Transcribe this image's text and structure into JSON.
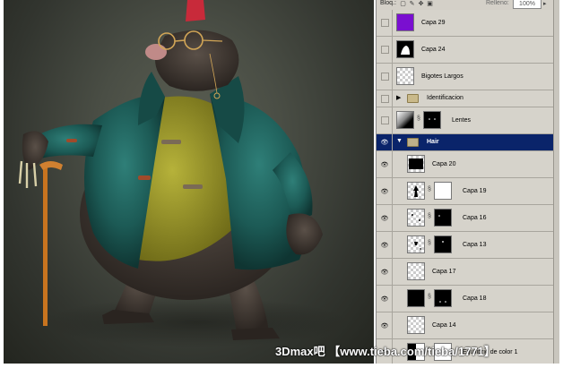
{
  "panel": {
    "lock_label": "Bloq.:",
    "fill_label": "Relleno:",
    "fill_value": "100%"
  },
  "layers": [
    {
      "name": "Capa 29",
      "visible": false,
      "thumb": "purple"
    },
    {
      "name": "Capa 24",
      "visible": false,
      "thumb": "white-shape-black"
    },
    {
      "name": "Bigotes Largos",
      "visible": false,
      "thumb": "checker"
    },
    {
      "name": "Identificacion",
      "visible": false,
      "type": "group",
      "expanded": false
    },
    {
      "name": "Lentes",
      "visible": false,
      "thumb": "gradient",
      "mask": "black-dots"
    },
    {
      "name": "Hair",
      "visible": true,
      "type": "group",
      "expanded": true,
      "selected": true
    },
    {
      "name": "Capa 20",
      "visible": true,
      "thumb": "black-checker"
    },
    {
      "name": "Capa 19",
      "visible": true,
      "thumb": "checker-figure",
      "mask": "white"
    },
    {
      "name": "Capa 16",
      "visible": true,
      "thumb": "checker-dots",
      "mask": "black-dots"
    },
    {
      "name": "Capa 13",
      "visible": true,
      "thumb": "checker-figure",
      "mask": "black-dots"
    },
    {
      "name": "Capa 17",
      "visible": true,
      "thumb": "checker"
    },
    {
      "name": "Capa 18",
      "visible": true,
      "thumb": "black",
      "mask": "black-dots"
    },
    {
      "name": "Capa 14",
      "visible": true,
      "thumb": "checker"
    },
    {
      "name": "Equilibrio de color 1",
      "visible": true,
      "thumb": "adjustment",
      "mask": "white"
    }
  ],
  "watermark": "3Dmax吧 【www.tieba.com/tieba/1771】",
  "colors": {
    "panel_bg": "#d4d0c8",
    "selection": "#0a246a",
    "purple_thumb": "#7a0fd0"
  }
}
